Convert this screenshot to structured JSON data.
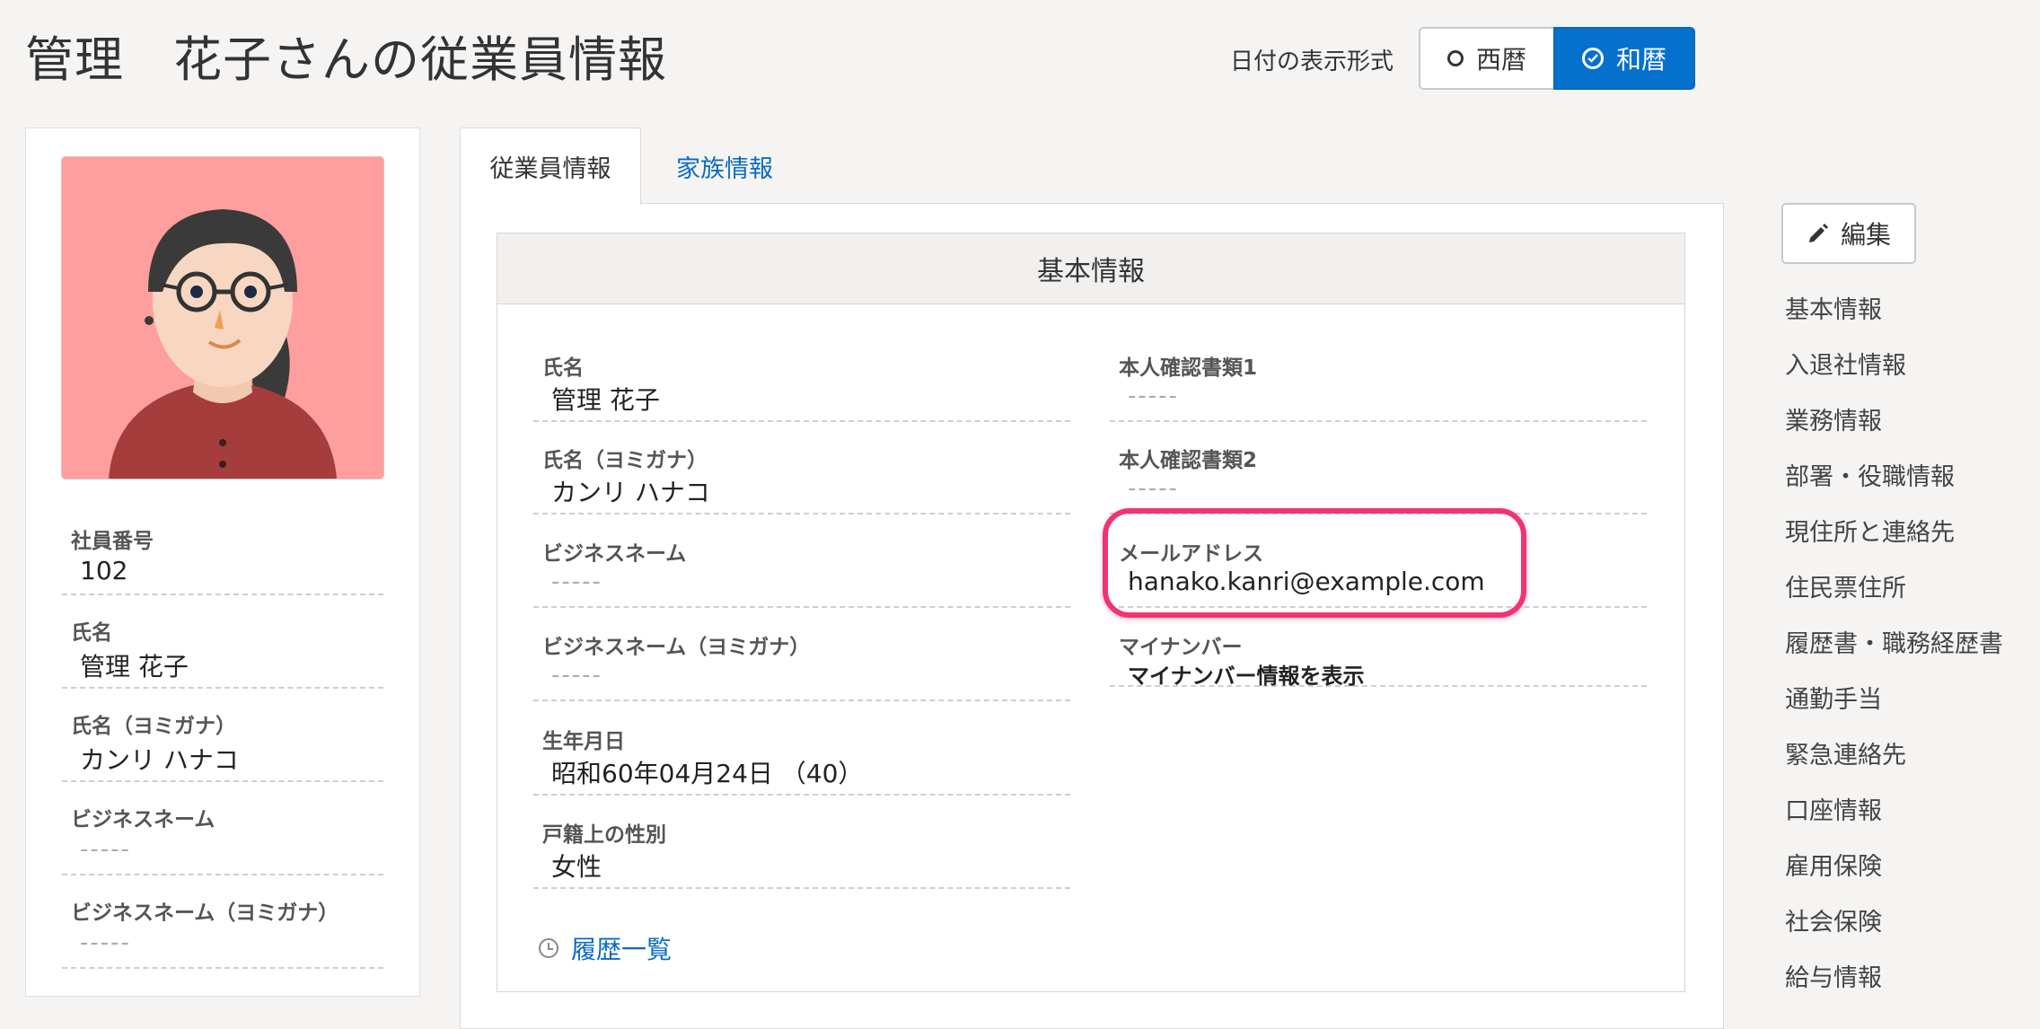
{
  "page_title": "管理　花子さんの従業員情報",
  "date_format": {
    "label": "日付の表示形式",
    "options": [
      "西暦",
      "和暦"
    ],
    "selected": "和暦"
  },
  "profile": {
    "fields": [
      {
        "label": "社員番号",
        "value": "102"
      },
      {
        "label": "氏名",
        "value": "管理 花子"
      },
      {
        "label": "氏名（ヨミガナ）",
        "value": "カンリ ハナコ"
      },
      {
        "label": "ビジネスネーム",
        "value": "-----"
      },
      {
        "label": "ビジネスネーム（ヨミガナ）",
        "value": "-----"
      }
    ]
  },
  "tabs": [
    {
      "label": "従業員情報",
      "active": true
    },
    {
      "label": "家族情報",
      "active": false
    }
  ],
  "basic_info": {
    "title": "基本情報",
    "left_fields": [
      {
        "label": "氏名",
        "value": "管理 花子"
      },
      {
        "label": "氏名（ヨミガナ）",
        "value": "カンリ ハナコ"
      },
      {
        "label": "ビジネスネーム",
        "value": "-----"
      },
      {
        "label": "ビジネスネーム（ヨミガナ）",
        "value": "-----"
      },
      {
        "label": "生年月日",
        "value": "昭和60年04月24日 （40）"
      },
      {
        "label": "戸籍上の性別",
        "value": "女性"
      }
    ],
    "right_fields": [
      {
        "label": "本人確認書類1",
        "value": "-----"
      },
      {
        "label": "本人確認書類2",
        "value": "-----"
      },
      {
        "label": "メールアドレス",
        "value": "hanako.kanri@example.com"
      },
      {
        "label": "マイナンバー",
        "value": "マイナンバー情報を表示"
      }
    ],
    "history_link": "履歴一覧"
  },
  "edit_button": "編集",
  "side_nav": [
    "基本情報",
    "入退社情報",
    "業務情報",
    "部署・役職情報",
    "現住所と連絡先",
    "住民票住所",
    "履歴書・職務経歴書",
    "通勤手当",
    "緊急連絡先",
    "口座情報",
    "雇用保険",
    "社会保険",
    "給与情報"
  ],
  "colors": {
    "accent": "#0571cd",
    "link": "#0b6ac2",
    "highlight": "#f0346f",
    "avatar_bg": "#ff9e9e"
  }
}
